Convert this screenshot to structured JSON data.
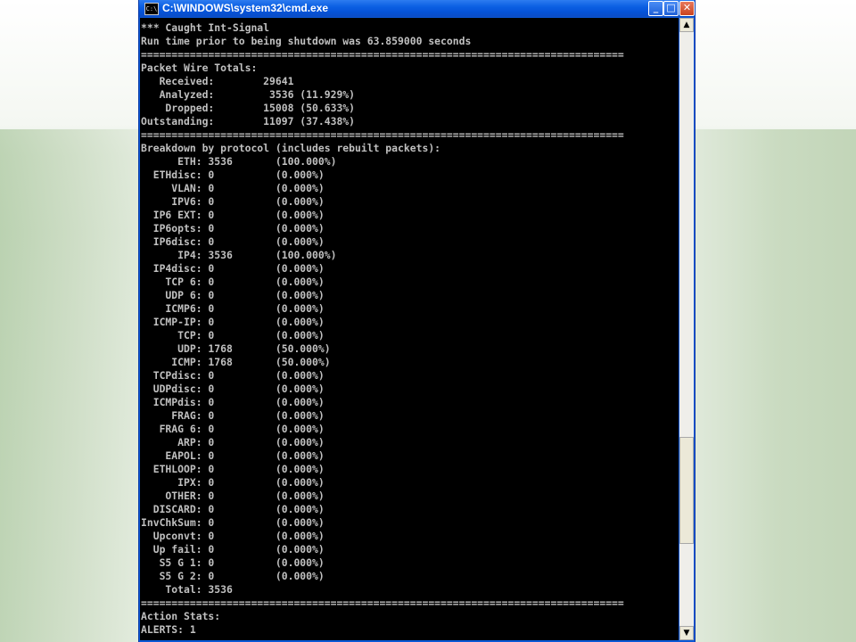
{
  "window": {
    "title": "C:\\WINDOWS\\system32\\cmd.exe",
    "icon": "C:\\",
    "controls": {
      "minimize": "_",
      "maximize": "□",
      "close": "✕"
    }
  },
  "scrollbar": {
    "up": "▲",
    "down": "▼"
  },
  "console": {
    "lines": [
      "*** Caught Int-Signal",
      "Run time prior to being shutdown was 63.859000 seconds",
      "===============================================================================",
      "Packet Wire Totals:",
      "   Received:        29641",
      "   Analyzed:         3536 (11.929%)",
      "    Dropped:        15008 (50.633%)",
      "Outstanding:        11097 (37.438%)",
      "===============================================================================",
      "Breakdown by protocol (includes rebuilt packets):",
      "      ETH: 3536       (100.000%)",
      "  ETHdisc: 0          (0.000%)",
      "     VLAN: 0          (0.000%)",
      "     IPV6: 0          (0.000%)",
      "  IP6 EXT: 0          (0.000%)",
      "  IP6opts: 0          (0.000%)",
      "  IP6disc: 0          (0.000%)",
      "      IP4: 3536       (100.000%)",
      "  IP4disc: 0          (0.000%)",
      "    TCP 6: 0          (0.000%)",
      "    UDP 6: 0          (0.000%)",
      "    ICMP6: 0          (0.000%)",
      "  ICMP-IP: 0          (0.000%)",
      "      TCP: 0          (0.000%)",
      "      UDP: 1768       (50.000%)",
      "     ICMP: 1768       (50.000%)",
      "  TCPdisc: 0          (0.000%)",
      "  UDPdisc: 0          (0.000%)",
      "  ICMPdis: 0          (0.000%)",
      "     FRAG: 0          (0.000%)",
      "   FRAG 6: 0          (0.000%)",
      "      ARP: 0          (0.000%)",
      "    EAPOL: 0          (0.000%)",
      "  ETHLOOP: 0          (0.000%)",
      "      IPX: 0          (0.000%)",
      "    OTHER: 0          (0.000%)",
      "  DISCARD: 0          (0.000%)",
      "InvChkSum: 0          (0.000%)",
      "  Upconvt: 0          (0.000%)",
      "  Up fail: 0          (0.000%)",
      "   S5 G 1: 0          (0.000%)",
      "   S5 G 2: 0          (0.000%)",
      "    Total: 3536",
      "===============================================================================",
      "Action Stats:",
      "ALERTS: 1"
    ]
  }
}
